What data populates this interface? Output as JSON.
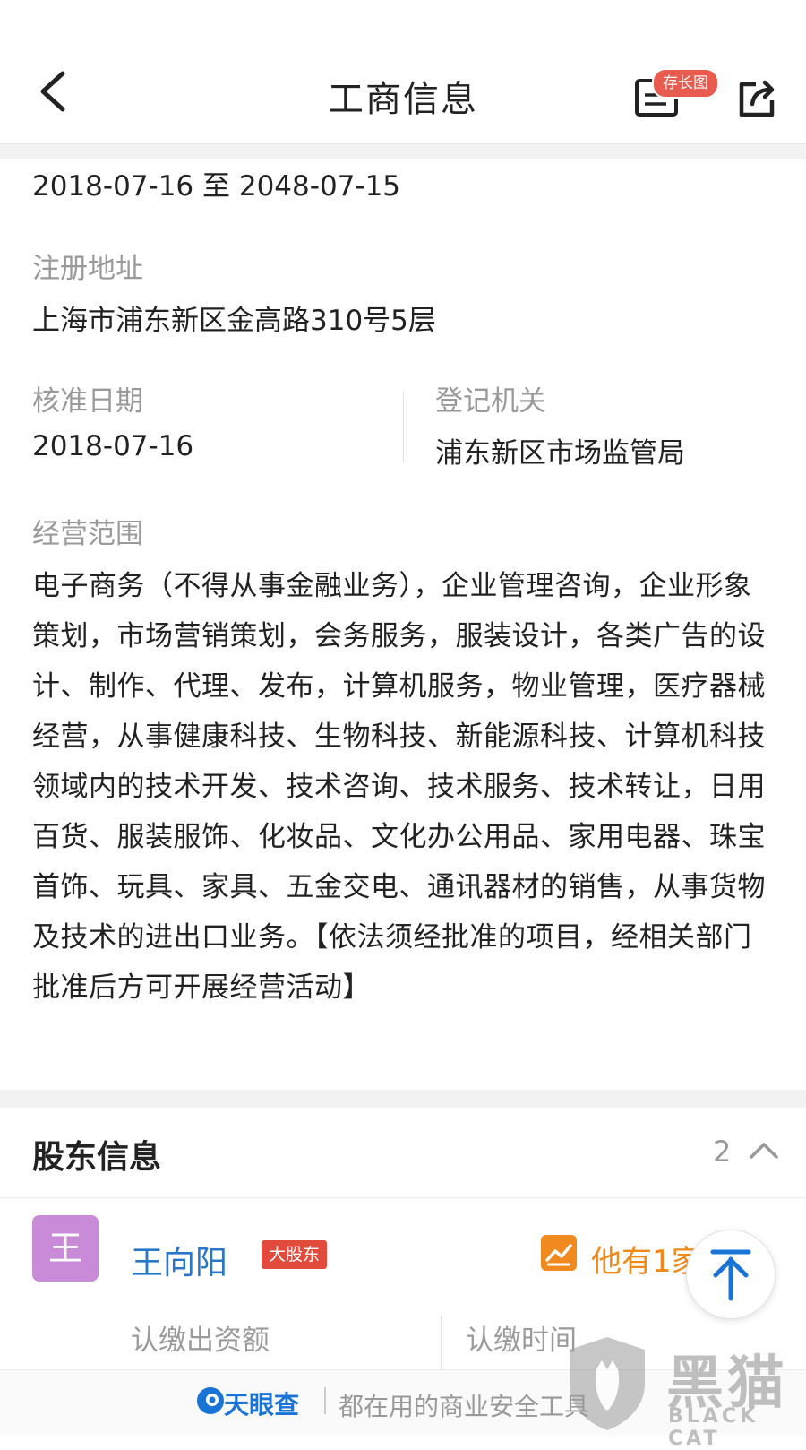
{
  "nav": {
    "title": "工商信息",
    "long_image_badge": "存长图"
  },
  "business_term": "2018-07-16 至 2048-07-15",
  "registered_address": {
    "label": "注册地址",
    "value": "上海市浦东新区金高路310号5层"
  },
  "approval_date": {
    "label": "核准日期",
    "value": "2018-07-16"
  },
  "registration_authority": {
    "label": "登记机关",
    "value": "浦东新区市场监管局"
  },
  "business_scope": {
    "label": "经营范围",
    "value": "电子商务（不得从事金融业务），企业管理咨询，企业形象策划，市场营销策划，会务服务，服装设计，各类广告的设计、制作、代理、发布，计算机服务，物业管理，医疗器械经营，从事健康科技、生物科技、新能源科技、计算机科技领域内的技术开发、技术咨询、技术服务、技术转让，日用百货、服装服饰、化妆品、文化办公用品、家用电器、珠宝首饰、玩具、家具、五金交电、通讯器材的销售，从事货物及技术的进出口业务。【依法须经批准的项目，经相关部门批准后方可开展经营活动】"
  },
  "shareholders": {
    "title": "股东信息",
    "count": "2",
    "items": [
      {
        "avatar_char": "王",
        "name": "王向阳",
        "badge": "大股东",
        "related_text": "他有1家",
        "col_amount": "认缴出资额",
        "col_time": "认缴时间"
      }
    ]
  },
  "footer": {
    "brand": "天眼查",
    "slogan": "都在用的商业安全工具"
  },
  "watermark": {
    "cn": "黑猫",
    "en": "BLACK CAT"
  },
  "colors": {
    "link_blue": "#2a77c9",
    "brand_blue": "#1a74d6",
    "badge_red": "#e24a3c",
    "orange": "#ef8a18",
    "avatar_purple": "#c98ad8",
    "label_gray": "#9a9a9a"
  },
  "icons": [
    "back-arrow-icon",
    "long-image-icon",
    "share-icon",
    "chevron-up-icon",
    "trend-icon",
    "scroll-top-arrow-icon",
    "tianyancha-logo-icon",
    "black-cat-shield-icon"
  ]
}
